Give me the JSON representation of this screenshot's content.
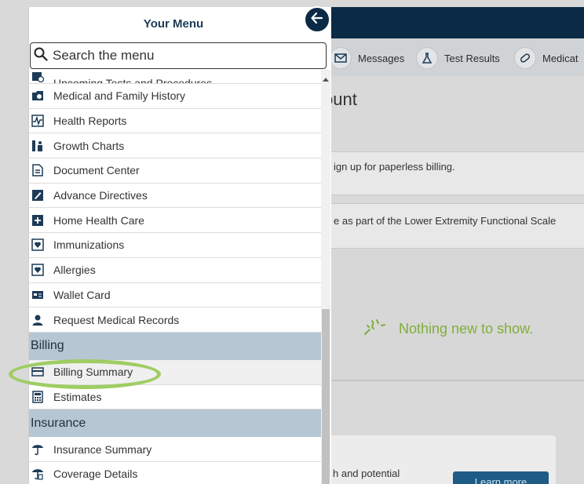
{
  "menu": {
    "title": "Your Menu",
    "search_placeholder": "Search the menu",
    "items_top": [
      {
        "label": "Upcoming Tests and Procedures",
        "icon": "calendar-icon"
      },
      {
        "label": "Medical and Family History",
        "icon": "folder-icon"
      },
      {
        "label": "Health Reports",
        "icon": "chart-pulse-icon"
      },
      {
        "label": "Growth Charts",
        "icon": "growth-chart-icon"
      },
      {
        "label": "Document Center",
        "icon": "document-icon"
      },
      {
        "label": "Advance Directives",
        "icon": "pen-icon"
      },
      {
        "label": "Home Health Care",
        "icon": "medical-kit-icon"
      },
      {
        "label": "Immunizations",
        "icon": "shield-heart-icon"
      },
      {
        "label": "Allergies",
        "icon": "allergy-icon"
      },
      {
        "label": "Wallet Card",
        "icon": "wallet-card-icon"
      },
      {
        "label": "Request Medical Records",
        "icon": "person-icon"
      }
    ],
    "billing_section": "Billing",
    "billing_items": [
      {
        "label": "Billing Summary",
        "icon": "credit-card-icon"
      },
      {
        "label": "Estimates",
        "icon": "calculator-icon"
      }
    ],
    "insurance_section": "Insurance",
    "insurance_items": [
      {
        "label": "Insurance Summary",
        "icon": "umbrella-icon"
      },
      {
        "label": "Coverage Details",
        "icon": "umbrella-coverage-icon"
      }
    ]
  },
  "background": {
    "quick_links": [
      "Messages",
      "Test Results",
      "Medicat"
    ],
    "page_title_fragment": "ount",
    "notice_1": "ign up for paperless billing.",
    "notice_2": "e as part of the Lower Extremity Functional Scale",
    "empty_state": "Nothing new to show.",
    "lower_card_text": "h and potential",
    "learn_more": "Learn more"
  },
  "colors": {
    "header_navy": "#0b2a45",
    "section_bg": "#b7c6d3",
    "highlight_green": "#9fcd63",
    "empty_state_green": "#7fae3a"
  }
}
